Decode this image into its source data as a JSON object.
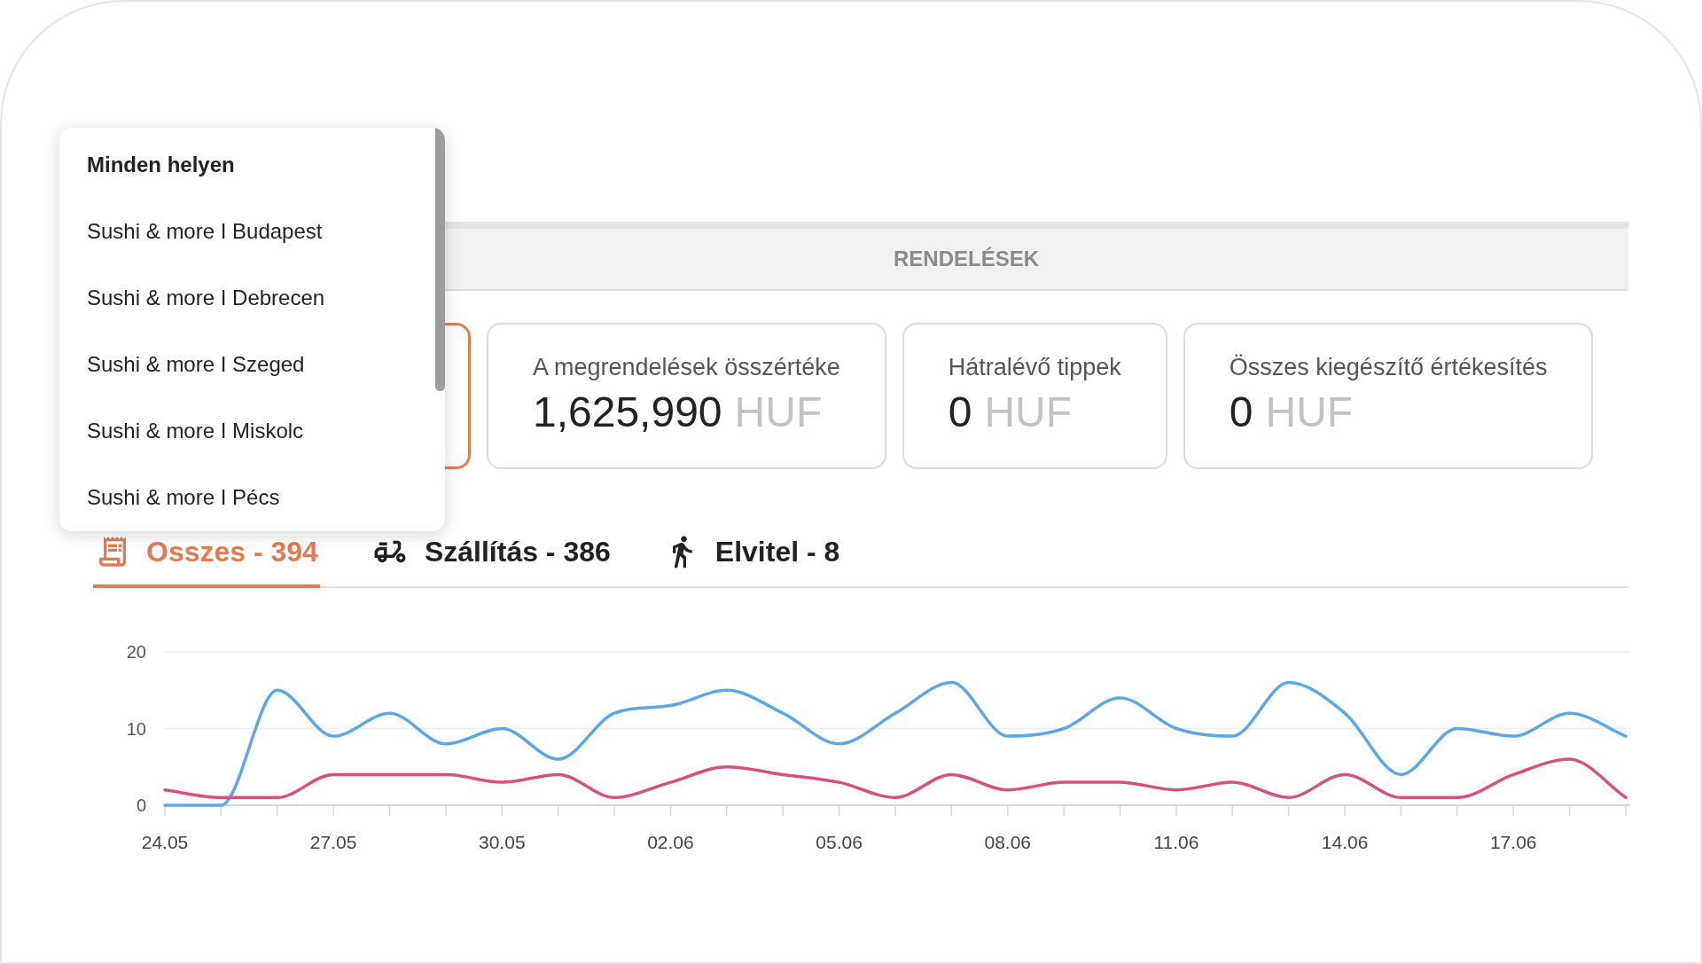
{
  "location_menu": {
    "items": [
      {
        "label": "Minden helyen",
        "selected": true
      },
      {
        "label": "Sushi & more I Budapest",
        "selected": false
      },
      {
        "label": "Sushi & more I Debrecen",
        "selected": false
      },
      {
        "label": "Sushi & more I Szeged",
        "selected": false
      },
      {
        "label": "Sushi & more I Miskolc",
        "selected": false
      },
      {
        "label": "Sushi & more I Pécs",
        "selected": false
      }
    ]
  },
  "section": {
    "title": "RENDELÉSEK"
  },
  "cards": [
    {
      "selected": true
    },
    {
      "label": "A megrendelések összértéke",
      "value": "1,625,990",
      "unit": "HUF",
      "selected": false
    },
    {
      "label": "Hátralévő tippek",
      "value": "0",
      "unit": "HUF",
      "selected": false
    },
    {
      "label": "Összes kiegészítő értékesítés",
      "value": "0",
      "unit": "HUF",
      "selected": false
    }
  ],
  "tabs": [
    {
      "kind": "all",
      "label": "Osszes - 394",
      "selected": true
    },
    {
      "kind": "delivery",
      "label": "Szállítás - 386",
      "selected": false
    },
    {
      "kind": "takeaway",
      "label": "Elvitel - 8",
      "selected": false
    }
  ],
  "orders_chart": {
    "chart_data": {
      "type": "line",
      "categories": [
        "24.05",
        null,
        null,
        "27.05",
        null,
        null,
        "30.05",
        null,
        null,
        "02.06",
        null,
        null,
        "05.06",
        null,
        null,
        "08.06",
        null,
        null,
        "11.06",
        null,
        null,
        "14.06",
        null,
        null,
        "17.06",
        null,
        null
      ],
      "ylim": [
        0,
        20
      ],
      "yticks": [
        0,
        10,
        20
      ],
      "series": [
        {
          "color": "#5ba8e3",
          "values": [
            0,
            0,
            15,
            9,
            12,
            8,
            10,
            6,
            12,
            13,
            15,
            12,
            8,
            12,
            16,
            9,
            10,
            14,
            10,
            9,
            16,
            12,
            4,
            10,
            9,
            12,
            9
          ]
        },
        {
          "color": "#d6517d",
          "values": [
            2,
            1,
            1,
            4,
            4,
            4,
            3,
            4,
            1,
            3,
            5,
            4,
            3,
            1,
            4,
            2,
            3,
            3,
            2,
            3,
            1,
            4,
            1,
            1,
            4,
            6,
            1
          ]
        }
      ]
    }
  }
}
